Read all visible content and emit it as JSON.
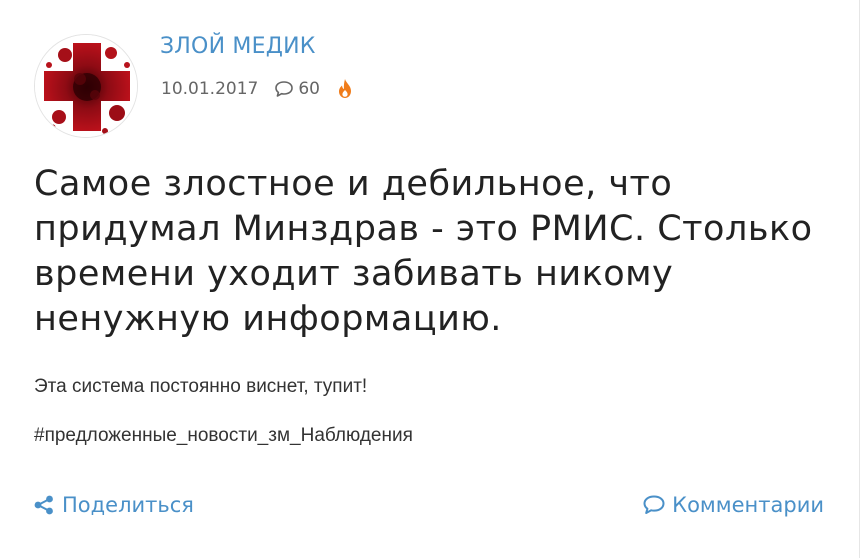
{
  "post": {
    "author": "ЗЛОЙ МЕДИК",
    "date": "10.01.2017",
    "comment_count": "60",
    "title": "Самое злостное и дебильное, что придумал Минздрав - это РМИС. Столько времени уходит забивать никому ненужную информацию.",
    "body": "Эта система постоянно виснет, тупит!",
    "hashtag": "#предложенные_новости_зм_Наблюдения"
  },
  "actions": {
    "share_label": "Поделиться",
    "comments_label": "Комментарии"
  },
  "icons": {
    "avatar": "red-cross-blood-splatter",
    "comments_meta": "speech-bubble-icon",
    "hot": "fire-icon",
    "share": "share-icon",
    "comments_action": "speech-bubble-icon"
  },
  "colors": {
    "link": "#4a90c8",
    "fire": "#f07c1a",
    "avatar_red": "#b0101a"
  }
}
